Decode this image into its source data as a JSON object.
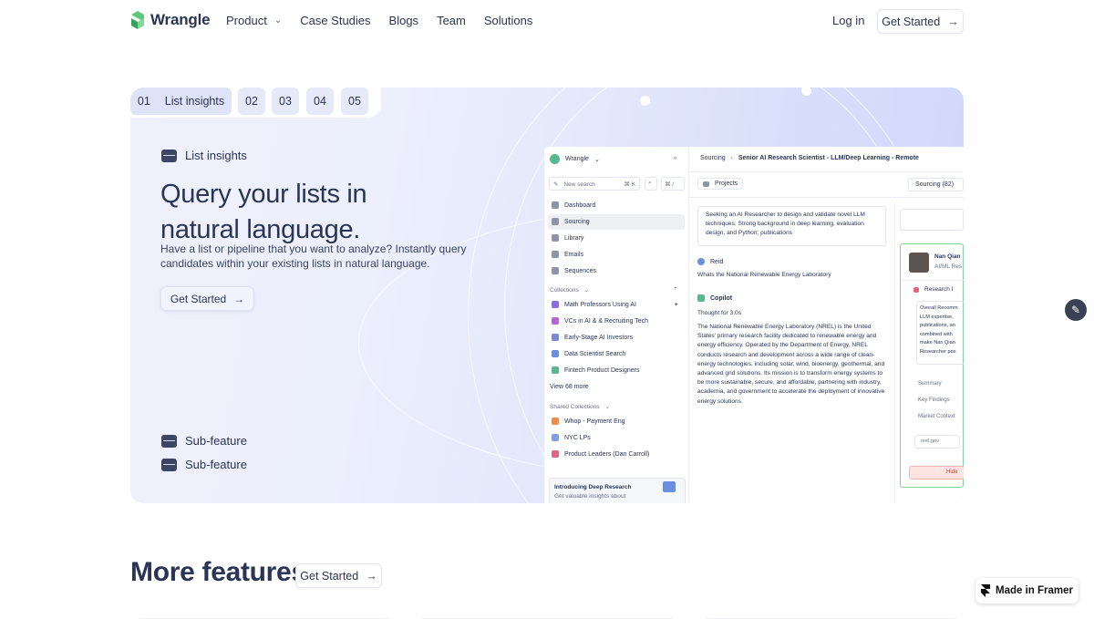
{
  "nav": {
    "brand": "Wrangle",
    "links": [
      "Product",
      "Case Studies",
      "Blogs",
      "Team",
      "Solutions"
    ],
    "login": "Log in",
    "cta": "Get Started"
  },
  "feature": {
    "tabs": [
      {
        "num": "01",
        "label": "List insights"
      },
      {
        "num": "02"
      },
      {
        "num": "03"
      },
      {
        "num": "04"
      },
      {
        "num": "05"
      }
    ],
    "section_label": "List insights",
    "headline": "Query your lists in natural language.",
    "description": "Have a list or pipeline that you want to analyze? Instantly query candidates within your existing lists in natural language.",
    "cta": "Get Started",
    "sub_features": [
      "Sub-feature",
      "Sub-feature"
    ]
  },
  "mockup": {
    "workspace": "Wrangle",
    "new_search": "New search",
    "shortcut1": "⌘ K",
    "shortcut2": "⌘ /",
    "nav_items": [
      "Dashboard",
      "Sourcing",
      "Library",
      "Emails",
      "Sequences"
    ],
    "collections_label": "Collections",
    "collections": [
      "Math Professors Using AI",
      "VCs in AI & & Recruiting Tech",
      "Early-Stage AI Investors",
      "Data Scientist Search",
      "Fintech Product Designers"
    ],
    "view_more": "View 68 more",
    "shared_label": "Shared Collections",
    "shared": [
      "Whop - Payment Eng",
      "NYC LPs",
      "Product Leaders (Dan Carroll)"
    ],
    "promo_title": "Introducing Deep Research",
    "promo_sub": "Get valuable insights about",
    "breadcrumb_root": "Sourcing",
    "breadcrumb_page": "Senior AI Research Scientist - LLM/Deep Learning - Remote",
    "projects": "Projects",
    "sourcing_count": "Sourcing (82)",
    "query_text": "Seeking an AI Researcher to design and validate novel LLM techniques. Strong background in deep learning, evaluation design, and Python; publications",
    "user_name": "Reid",
    "user_question": "Whats the National Renewable Energy Laboratory",
    "copilot": "Copilot",
    "thought": "Thought for 3.0s",
    "answer": "The National Renewable Energy Laboratory (NREL) is the United States' primary research facility dedicated to renewable energy and energy efficiency. Operated by the Department of Energy, NREL conducts research and development across a wide range of clean-energy technologies, including solar, wind, bioenergy, geothermal, and advanced grid solutions. Its mission is to transform energy systems to be more sustainable, secure, and affordable, partnering with industry, academia, and government to accelerate the deployment of innovative energy solutions.",
    "profile_name": "Nan Qian",
    "profile_role": "AI/ML Res",
    "research_tab": "Research I",
    "overall": "Overall Recomm LLM expertise, publications, an combined with make Nan Qian Researcher pos",
    "summary": "Summary",
    "key_findings": "Key Findings",
    "market_context": "Market Context",
    "source": "nrel.gov",
    "hide": "Hide"
  },
  "more": {
    "title": "More features",
    "cta": "Get Started"
  },
  "framer_badge": "Made in Framer"
}
